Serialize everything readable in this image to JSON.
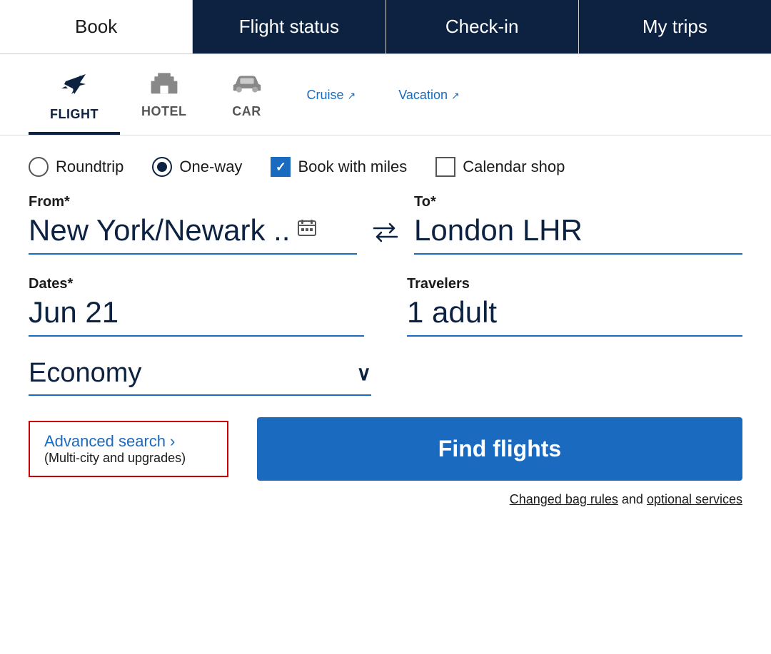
{
  "topNav": {
    "items": [
      {
        "id": "book",
        "label": "Book",
        "active": true,
        "dark": false
      },
      {
        "id": "flight-status",
        "label": "Flight status",
        "active": false,
        "dark": true
      },
      {
        "id": "check-in",
        "label": "Check-in",
        "active": false,
        "dark": true
      },
      {
        "id": "my-trips",
        "label": "My trips",
        "active": false,
        "dark": true
      }
    ]
  },
  "serviceTabs": {
    "tabs": [
      {
        "id": "flight",
        "label": "FLIGHT",
        "active": true,
        "type": "tab"
      },
      {
        "id": "hotel",
        "label": "HOTEL",
        "active": false,
        "type": "tab"
      },
      {
        "id": "car",
        "label": "CAR",
        "active": false,
        "type": "tab"
      },
      {
        "id": "cruise",
        "label": "Cruise ↗",
        "active": false,
        "type": "link"
      },
      {
        "id": "vacation",
        "label": "Vacation ↗",
        "active": false,
        "type": "link"
      }
    ]
  },
  "tripType": {
    "options": [
      {
        "id": "roundtrip",
        "label": "Roundtrip",
        "selected": false
      },
      {
        "id": "one-way",
        "label": "One-way",
        "selected": true
      }
    ],
    "checkboxes": [
      {
        "id": "book-with-miles",
        "label": "Book with miles",
        "checked": true
      },
      {
        "id": "calendar-shop",
        "label": "Calendar shop",
        "checked": false
      }
    ]
  },
  "fromField": {
    "label": "From*",
    "value": "New York/Newark ..",
    "iconLabel": "airport-selector-icon"
  },
  "toField": {
    "label": "To*",
    "value": "London LHR"
  },
  "swapIcon": "⇄",
  "datesField": {
    "label": "Dates*",
    "value": "Jun 21"
  },
  "travelersField": {
    "label": "Travelers",
    "value": "1 adult"
  },
  "cabinField": {
    "value": "Economy",
    "arrowLabel": "∨"
  },
  "advancedSearch": {
    "title": "Advanced search",
    "chevron": "›",
    "subtitle": "(Multi-city and upgrades)"
  },
  "findFlightsButton": "Find flights",
  "bagRules": {
    "text1": "Changed bag rules",
    "text2": " and ",
    "text3": "optional services"
  }
}
